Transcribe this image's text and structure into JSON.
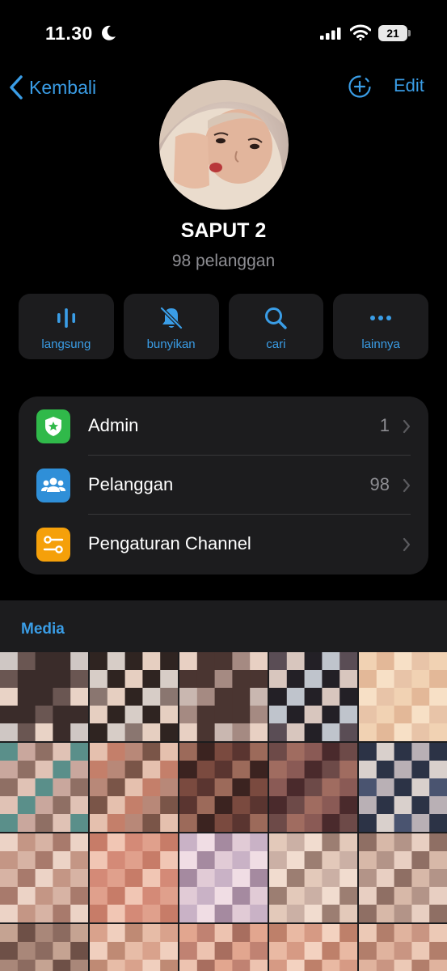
{
  "status_bar": {
    "time": "11.30",
    "battery": "21"
  },
  "nav": {
    "back_label": "Kembali",
    "edit_label": "Edit"
  },
  "channel": {
    "name": "SAPUT 2",
    "subscribers": "98 pelanggan"
  },
  "actions": [
    {
      "label": "langsung",
      "icon": "live-stream-icon"
    },
    {
      "label": "bunyikan",
      "icon": "bell-muted-icon"
    },
    {
      "label": "cari",
      "icon": "search-icon"
    },
    {
      "label": "lainnya",
      "icon": "more-icon"
    }
  ],
  "settings": [
    {
      "label": "Admin",
      "value": "1",
      "icon": "admin-badge-icon",
      "color": "#30b94a"
    },
    {
      "label": "Pelanggan",
      "value": "98",
      "icon": "subscribers-icon",
      "color": "#2f8fd8"
    },
    {
      "label": "Pengaturan Channel",
      "value": "",
      "icon": "settings-sliders-icon",
      "color": "#f5a00a"
    }
  ],
  "media": {
    "tab_label": "Media"
  },
  "colors": {
    "accent": "#3a9de6",
    "background": "#000000",
    "card": "#1c1c1e"
  }
}
